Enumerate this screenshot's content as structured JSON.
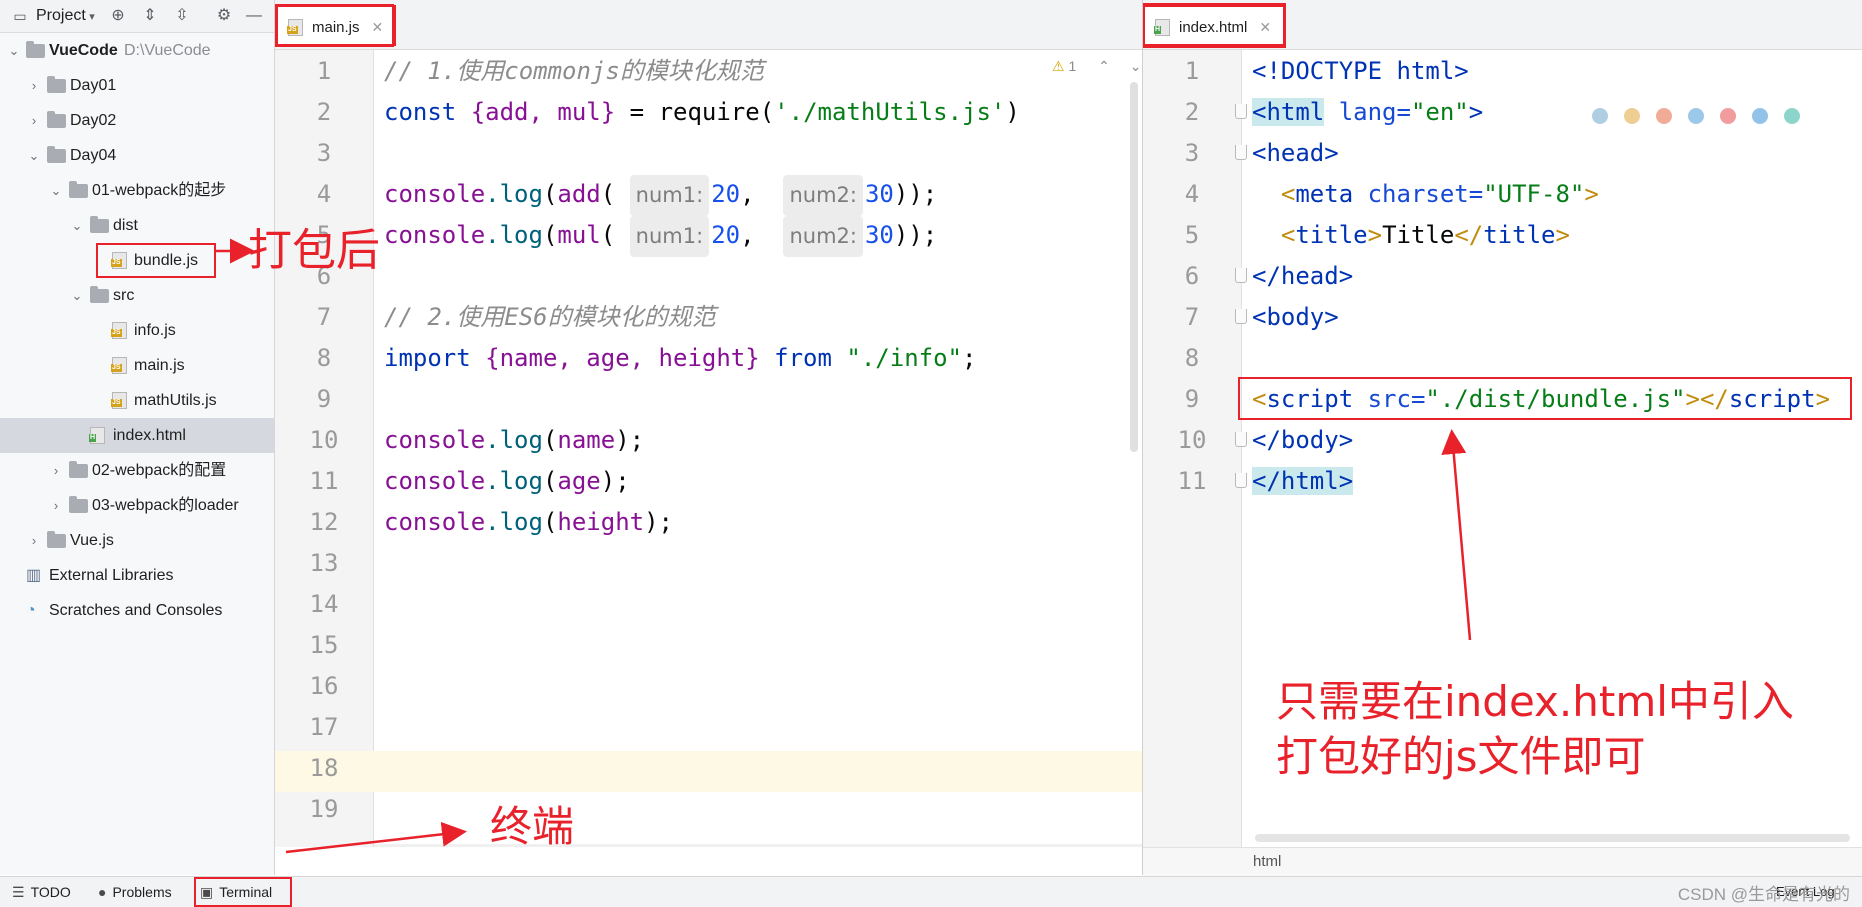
{
  "project_panel": {
    "title": "Project",
    "tree": [
      {
        "label": "VueCode",
        "hint": "D:\\VueCode"
      },
      {
        "label": "Day01"
      },
      {
        "label": "Day02"
      },
      {
        "label": "Day04"
      },
      {
        "label": "01-webpack的起步"
      },
      {
        "label": "dist"
      },
      {
        "label": "bundle.js"
      },
      {
        "label": "src"
      },
      {
        "label": "info.js"
      },
      {
        "label": "main.js"
      },
      {
        "label": "mathUtils.js"
      },
      {
        "label": "index.html"
      },
      {
        "label": "02-webpack的配置"
      },
      {
        "label": "03-webpack的loader"
      },
      {
        "label": "Vue.js"
      },
      {
        "label": "External Libraries"
      },
      {
        "label": "Scratches and Consoles"
      }
    ]
  },
  "left_editor": {
    "tab_label": "main.js",
    "tab_icon_tag": "JS",
    "inspection": "1",
    "line_numbers": [
      "1",
      "2",
      "3",
      "4",
      "5",
      "6",
      "7",
      "8",
      "9",
      "10",
      "11",
      "12",
      "13",
      "14",
      "15",
      "16",
      "17",
      "18",
      "19"
    ],
    "code": {
      "l1": "// 1.使用commonjs的模块化规范",
      "l2_kw": "const",
      "l2_names": "{add, mul}",
      "l2_eq": " = ",
      "l2_fn": "require",
      "l2_str": "'./mathUtils.js'",
      "console": "console",
      "log": ".log",
      "add": "add",
      "mul": "mul",
      "hint_num1": "num1:",
      "hint_num2": "num2:",
      "v20": "20",
      "v30": "30",
      "l7": "// 2.使用ES6的模块化的规范",
      "l8_kw": "import",
      "l8_names": "{name, age, height}",
      "l8_from": "from",
      "l8_str": "\"./info\"",
      "name": "name",
      "age": "age",
      "height": "height"
    }
  },
  "right_editor": {
    "tab_label": "index.html",
    "tab_icon_tag": "H",
    "line_numbers": [
      "1",
      "2",
      "3",
      "4",
      "5",
      "6",
      "7",
      "8",
      "9",
      "10",
      "11"
    ],
    "code": {
      "l1": "<!DOCTYPE html>",
      "l2_tag": "<html",
      "l2_attr": " lang=",
      "l2_val": "\"en\"",
      "l2_close": ">",
      "l3": "<head>",
      "l4_tag": "meta",
      "l4_attr": " charset=",
      "l4_val": "\"UTF-8\"",
      "l5_tag": "title",
      "l5_text": "Title",
      "l6": "</head>",
      "l7": "<body>",
      "l9_tag": "script",
      "l9_attr": " src=",
      "l9_val": "\"./dist/bundle.js\"",
      "l10": "</body>",
      "l11": "</html>"
    },
    "breadcrumb": "html"
  },
  "bottom_bar": {
    "todo": "TODO",
    "problems": "Problems",
    "terminal": "Terminal",
    "event_log": "Event Log",
    "watermark": "CSDN @生命是有光的"
  },
  "annotations": {
    "after_pack": "打包后",
    "terminal_note": "终端",
    "note_line1": "只需要在index.html中引入",
    "note_line2": "打包好的js文件即可",
    "color": "#e8212a"
  },
  "colors": {
    "keyword": "#0033b3",
    "string": "#067d17",
    "number": "#1750eb",
    "comment": "#8c8c8c",
    "property": "#871094",
    "annotation_red": "#e8212a"
  }
}
